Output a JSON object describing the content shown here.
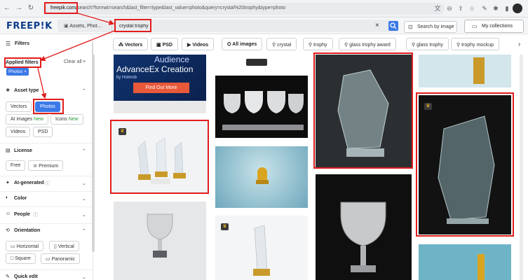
{
  "browser": {
    "url_host": "freepik.com",
    "url_path": "/search?format=search&last_filter=type&last_value=photo&query=crystal%20trophy&type=photo"
  },
  "header": {
    "logo": "FREEP!K",
    "search_scope": "Assets, Phot...",
    "search_query": "crystal trophy",
    "search_by_image": "Search by image",
    "my_collections": "My collections"
  },
  "sidebar": {
    "filters_label": "Filters",
    "applied_filters_label": "Applied filters",
    "clear_all": "Clear all",
    "applied_chip": "Photos",
    "asset_type": {
      "label": "Asset type",
      "options": [
        "Vectors",
        "Photos",
        "AI images",
        "Icons",
        "Videos",
        "PSD"
      ],
      "new_badge": "New"
    },
    "license": {
      "label": "License",
      "options": [
        "Free",
        "Premium"
      ]
    },
    "ai_generated": {
      "label": "AI-generated"
    },
    "color": {
      "label": "Color"
    },
    "people": {
      "label": "People"
    },
    "orientation": {
      "label": "Orientation",
      "options": [
        "Horizontal",
        "Vertical",
        "Square",
        "Panoramic"
      ]
    },
    "quick_edit": {
      "label": "Quick edit"
    }
  },
  "tags": [
    "Vectors",
    "PSD",
    "Videos",
    "All images",
    "crystal",
    "trophy",
    "glass trophy award",
    "glass trophy",
    "trophy mockup"
  ],
  "ad": {
    "line1": "Audience",
    "line2": "AdvanceEx Creation",
    "byline": "by Hotmob",
    "cta": "Find Out More"
  },
  "colors": {
    "accent": "#3b79e8",
    "annotation_red": "#e11d1d",
    "logo": "#0e3d8c",
    "new_badge": "#2d9b3c"
  }
}
